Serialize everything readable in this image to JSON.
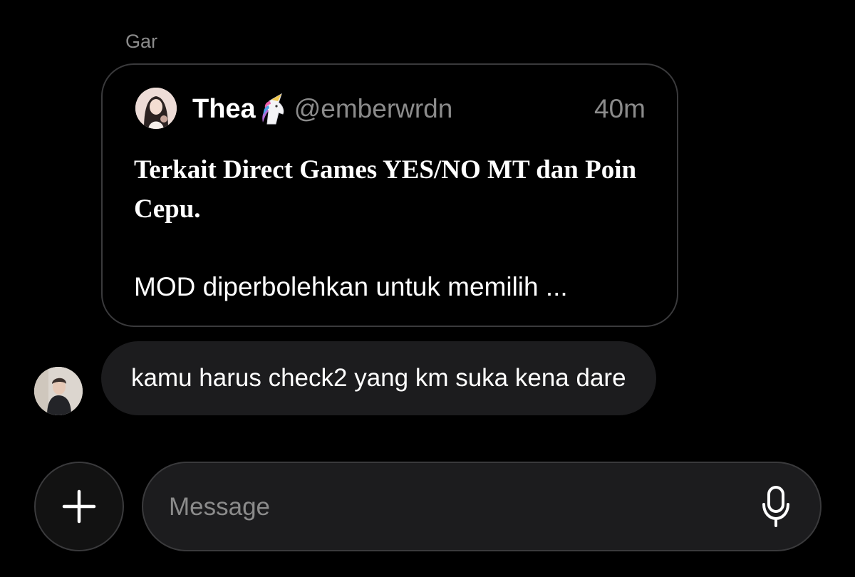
{
  "conversation": {
    "sender_name": "Gar"
  },
  "quoted_post": {
    "author_name": "Thea",
    "author_emoji": "unicorn-icon",
    "author_handle": "@emberwrdn",
    "time": "40m",
    "title": "Terkait Direct Games YES/NO MT dan Poin Cepu.",
    "body_preview": "MOD diperbolehkan untuk memilih ..."
  },
  "message": {
    "text": "kamu harus check2 yang km suka kena dare"
  },
  "composer": {
    "placeholder": "Message",
    "add_icon": "plus-icon",
    "mic_icon": "microphone-icon"
  },
  "colors": {
    "background": "#000000",
    "bubble": "#1c1c1e",
    "border": "#3a3a3c",
    "secondary_text": "#8b8b8b",
    "primary_text": "#ffffff"
  }
}
